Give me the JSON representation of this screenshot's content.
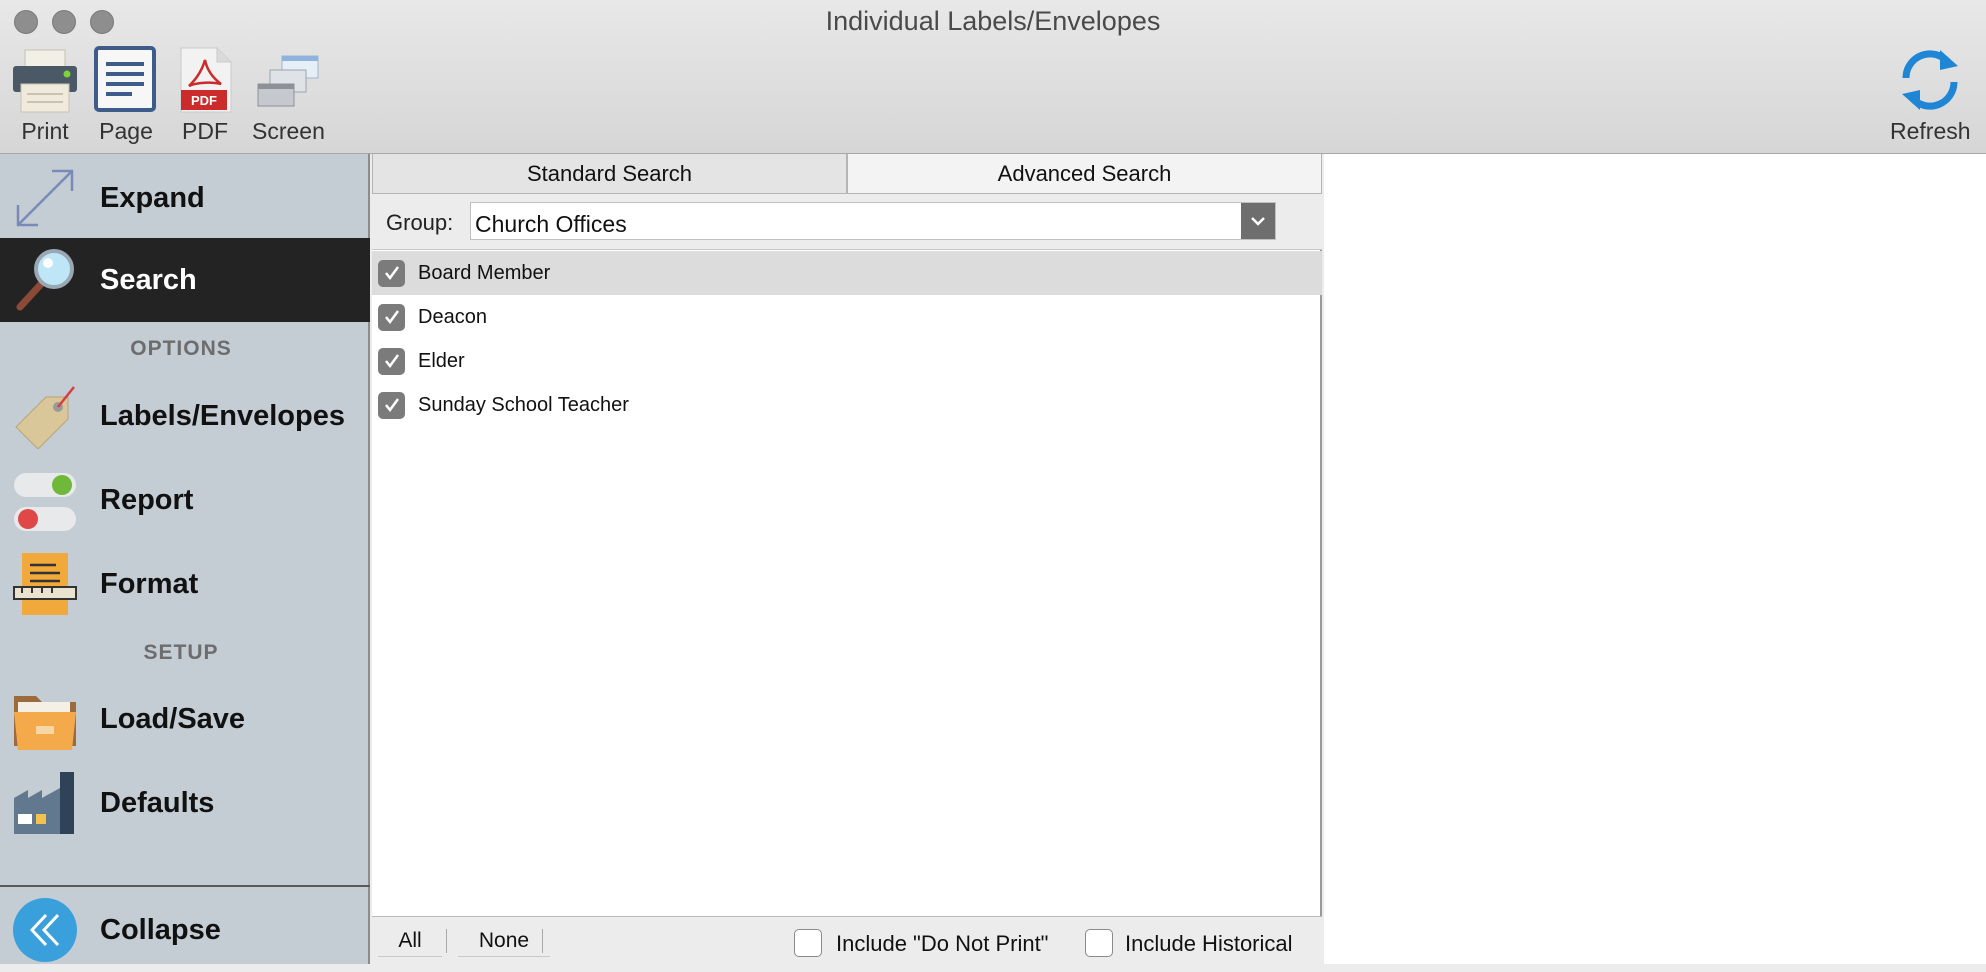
{
  "window": {
    "title": "Individual Labels/Envelopes"
  },
  "toolbar": {
    "print_label": "Print",
    "page_label": "Page",
    "pdf_label": "PDF",
    "pdf_icon_text": "PDF",
    "screen_label": "Screen",
    "refresh_label": "Refresh"
  },
  "sidebar": {
    "expand_label": "Expand",
    "search_label": "Search",
    "options_header": "OPTIONS",
    "labels_label": "Labels/Envelopes",
    "report_label": "Report",
    "format_label": "Format",
    "setup_header": "SETUP",
    "loadsave_label": "Load/Save",
    "defaults_label": "Defaults",
    "collapse_label": "Collapse"
  },
  "search": {
    "tabs": [
      {
        "label": "Standard Search",
        "selected": true
      },
      {
        "label": "Advanced Search",
        "selected": false
      }
    ],
    "group_label": "Group:",
    "group_value": "Church Offices",
    "items": [
      {
        "label": "Board Member",
        "checked": true
      },
      {
        "label": "Deacon",
        "checked": true
      },
      {
        "label": "Elder",
        "checked": true
      },
      {
        "label": "Sunday School Teacher",
        "checked": true
      }
    ],
    "all_label": "All",
    "none_label": "None",
    "include_dnp_label": "Include \"Do Not Print\"",
    "include_dnp_checked": false,
    "include_historical_label": "Include Historical",
    "include_historical_checked": false
  },
  "colors": {
    "sidebar_bg": "#c4ccd4",
    "active_bg": "#232323",
    "refresh_blue": "#1f86d6",
    "collapse_blue": "#3aa0dc"
  }
}
